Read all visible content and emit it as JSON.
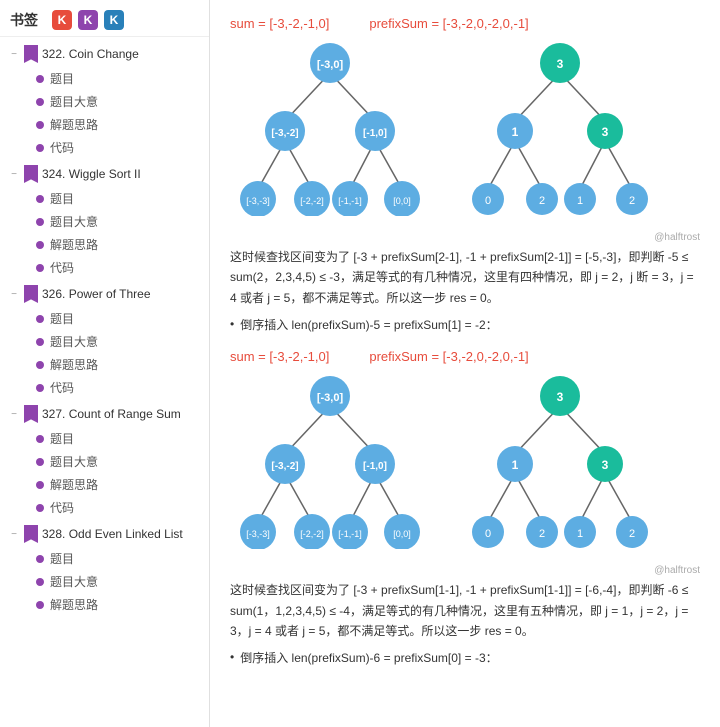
{
  "sidebar": {
    "title": "书签",
    "headerIcons": [
      {
        "label": "K",
        "color": "red"
      },
      {
        "label": "K",
        "color": "purple"
      },
      {
        "label": "K",
        "color": "blue"
      }
    ],
    "sections": [
      {
        "id": "322",
        "title": "322. Coin Change",
        "collapsed": false,
        "items": [
          "题目",
          "题目大意",
          "解题思路",
          "代码"
        ]
      },
      {
        "id": "324",
        "title": "324. Wiggle Sort II",
        "collapsed": false,
        "items": [
          "题目",
          "题目大意",
          "解题思路",
          "代码"
        ]
      },
      {
        "id": "326",
        "title": "326. Power of Three",
        "collapsed": false,
        "items": [
          "题目",
          "题目大意",
          "解题思路",
          "代码"
        ]
      },
      {
        "id": "327",
        "title": "327. Count of Range Sum",
        "collapsed": false,
        "items": [
          "题目",
          "题目大意",
          "解题思路",
          "代码"
        ]
      },
      {
        "id": "328",
        "title": "328. Odd Even Linked List",
        "collapsed": false,
        "items": [
          "题目",
          "题目大意",
          "解题思路"
        ]
      }
    ]
  },
  "content": {
    "block1": {
      "sumFormula": "sum = [-3,-2,-1,0]",
      "prefixSumFormula": "prefixSum = [-3,-2,0,-2,0,-1]",
      "watermark1": "@halftrost",
      "paragraph1": "这时候查找区间变为了 [-3 + prefixSum[2-1], -1 + prefixSum[2-1]] = [-5,-3]，即判断 -5 ≤ sum(2，2,3,4,5) ≤ -3，满足等式的有几种情况，这里有四种情况，即 j = 2，j断 = 3，j = 4 或者 j = 5，都不满足等式。所以这一步 res = 0。",
      "bullet1": "倒序插入 len(prefixSum)-5 = prefixSum[1] = -2："
    },
    "block2": {
      "sumFormula": "sum = [-3,-2,-1,0]",
      "prefixSumFormula": "prefixSum = [-3,-2,0,-2,0,-1]",
      "watermark2": "@halftrost",
      "paragraph2": "这时候查找区间变为了 [-3 + prefixSum[1-1], -1 + prefixSum[1-1]] = [-6,-4]，即判断 -6 ≤ sum(1，1,2,3,4,5) ≤ -4，满足等式的有几种情况，这里有五种情况，即 j = 1，j = 2，j = 3，j = 4 或者 j = 5，都不满足等式。所以这一步 res = 0。",
      "bullet2": "倒序插入 len(prefixSum)-6 = prefixSum[0] = -3："
    }
  }
}
